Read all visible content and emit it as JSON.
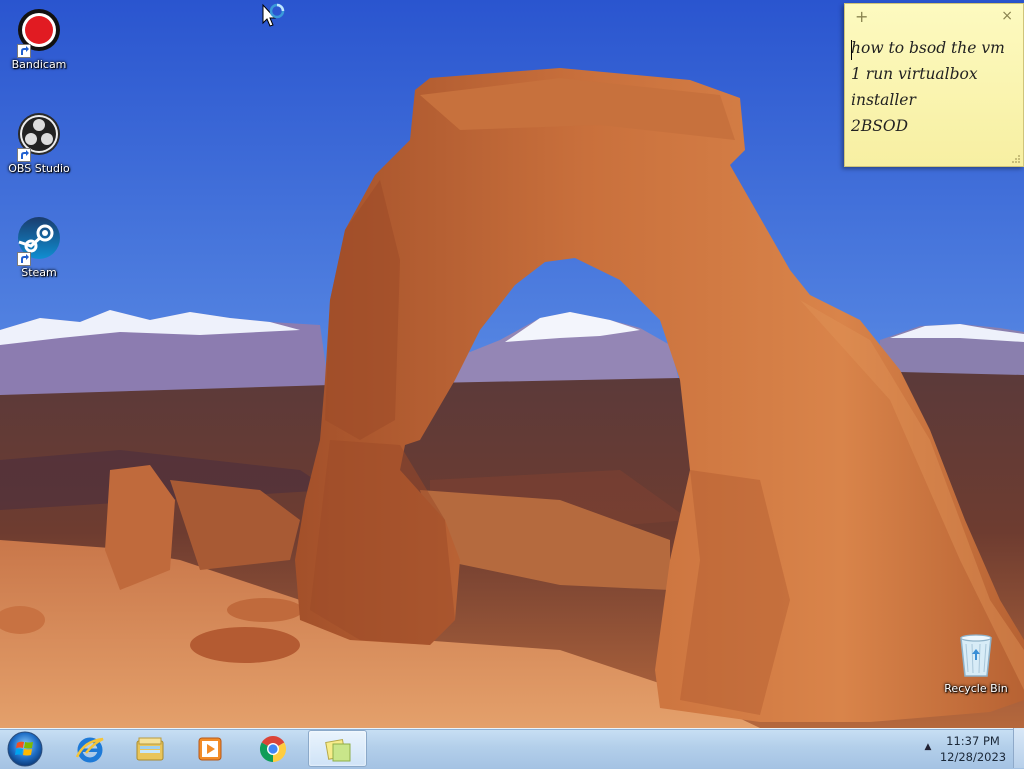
{
  "desktop": {
    "icons": [
      {
        "label": "Bandicam"
      },
      {
        "label": "OBS Studio"
      },
      {
        "label": "Steam"
      }
    ],
    "recycle_bin": {
      "label": "Recycle Bin"
    }
  },
  "sticky_note": {
    "lines": [
      "how to bsod the vm",
      "1 run virtualbox",
      "installer",
      "2BSOD"
    ],
    "add_glyph": "+",
    "close_glyph": "×"
  },
  "taskbar": {
    "pinned": [
      "internet-explorer",
      "windows-explorer",
      "media-player",
      "chrome",
      "sticky-notes"
    ],
    "clock": {
      "time": "11:37 PM",
      "date": "12/28/2023"
    }
  },
  "colors": {
    "sky_top": "#2f5fd2",
    "sticky_note": "#fbf5b0",
    "taskbar": "#b8d2ec"
  }
}
